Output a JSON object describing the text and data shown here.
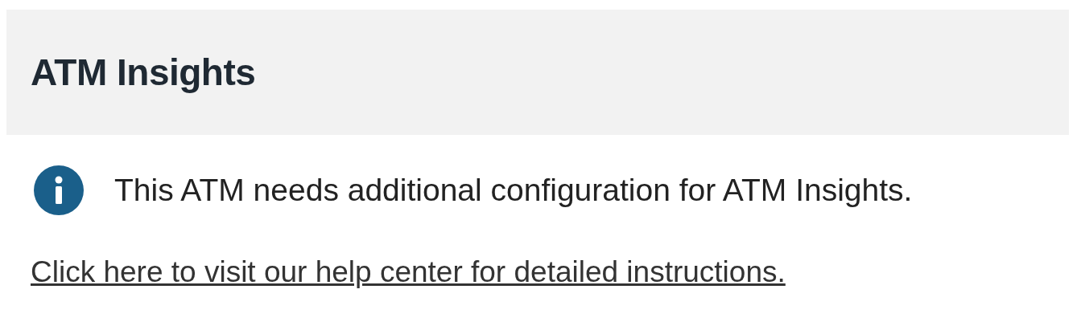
{
  "header": {
    "title": "ATM Insights"
  },
  "notice": {
    "message": "This ATM needs additional configuration for ATM Insights."
  },
  "help_link": {
    "label": "Click here to visit our help center for detailed instructions."
  }
}
